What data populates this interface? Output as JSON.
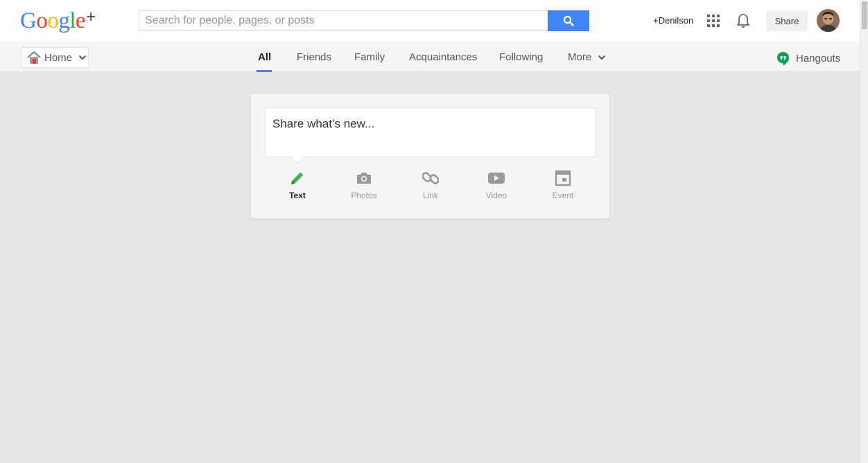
{
  "logo": {
    "text": "Google",
    "plus": "+"
  },
  "search": {
    "placeholder": "Search for people, pages, or posts",
    "value": ""
  },
  "header": {
    "profile_link": "+Denilson",
    "share_label": "Share",
    "apps_icon": "apps-grid-icon",
    "notifications_icon": "bell-icon"
  },
  "nav": {
    "home_label": "Home",
    "tabs": [
      {
        "label": "All",
        "active": true
      },
      {
        "label": "Friends"
      },
      {
        "label": "Family"
      },
      {
        "label": "Acquaintances"
      },
      {
        "label": "Following"
      },
      {
        "label": "More"
      }
    ],
    "hangouts_label": "Hangouts"
  },
  "share_card": {
    "placeholder": "Share what’s new...",
    "tools": [
      {
        "label": "Text",
        "icon": "pencil-icon",
        "active": true
      },
      {
        "label": "Photos",
        "icon": "camera-icon"
      },
      {
        "label": "Link",
        "icon": "link-icon"
      },
      {
        "label": "Video",
        "icon": "video-icon"
      },
      {
        "label": "Event",
        "icon": "event-icon"
      }
    ]
  },
  "colors": {
    "accent": "#4285f4",
    "active_tool": "#4caf50",
    "hangouts": "#0f9d58",
    "background": "#e5e5e5"
  }
}
